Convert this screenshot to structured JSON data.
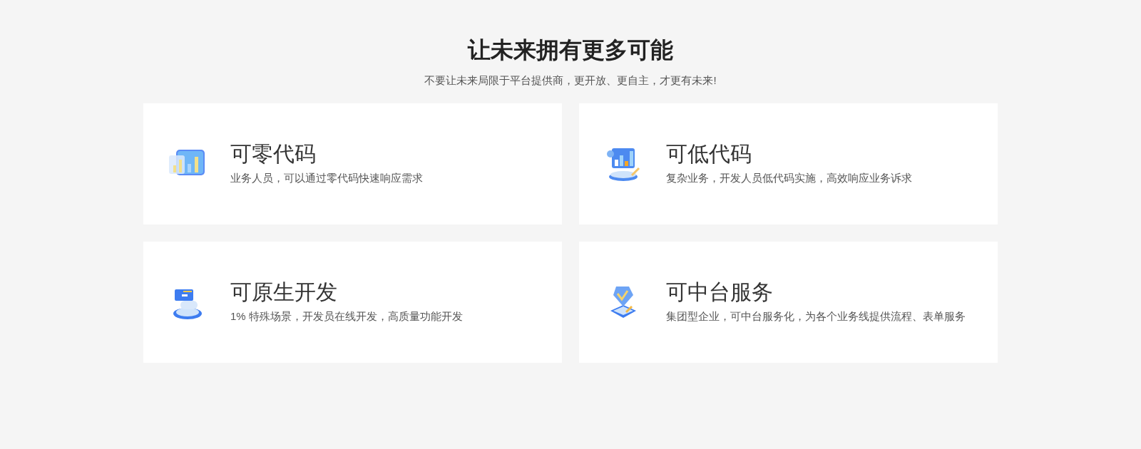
{
  "heading": "让未来拥有更多可能",
  "subheading": "不要让未来局限于平台提供商，更开放、更自主，才更有未来!",
  "cards": [
    {
      "kind": "chart",
      "title": "可零代码",
      "description": "业务人员，可以通过零代码快速响应需求"
    },
    {
      "kind": "monitor",
      "title": "可低代码",
      "description": "复杂业务，开发人员低代码实施，高效响应业务诉求"
    },
    {
      "kind": "stack",
      "title": "可原生开发",
      "description": "1% 特殊场景，开发员在线开发，高质量功能开发"
    },
    {
      "kind": "shield",
      "title": "可中台服务",
      "description": "集团型企业，可中台服务化，为各个业务线提供流程、表单服务"
    }
  ]
}
